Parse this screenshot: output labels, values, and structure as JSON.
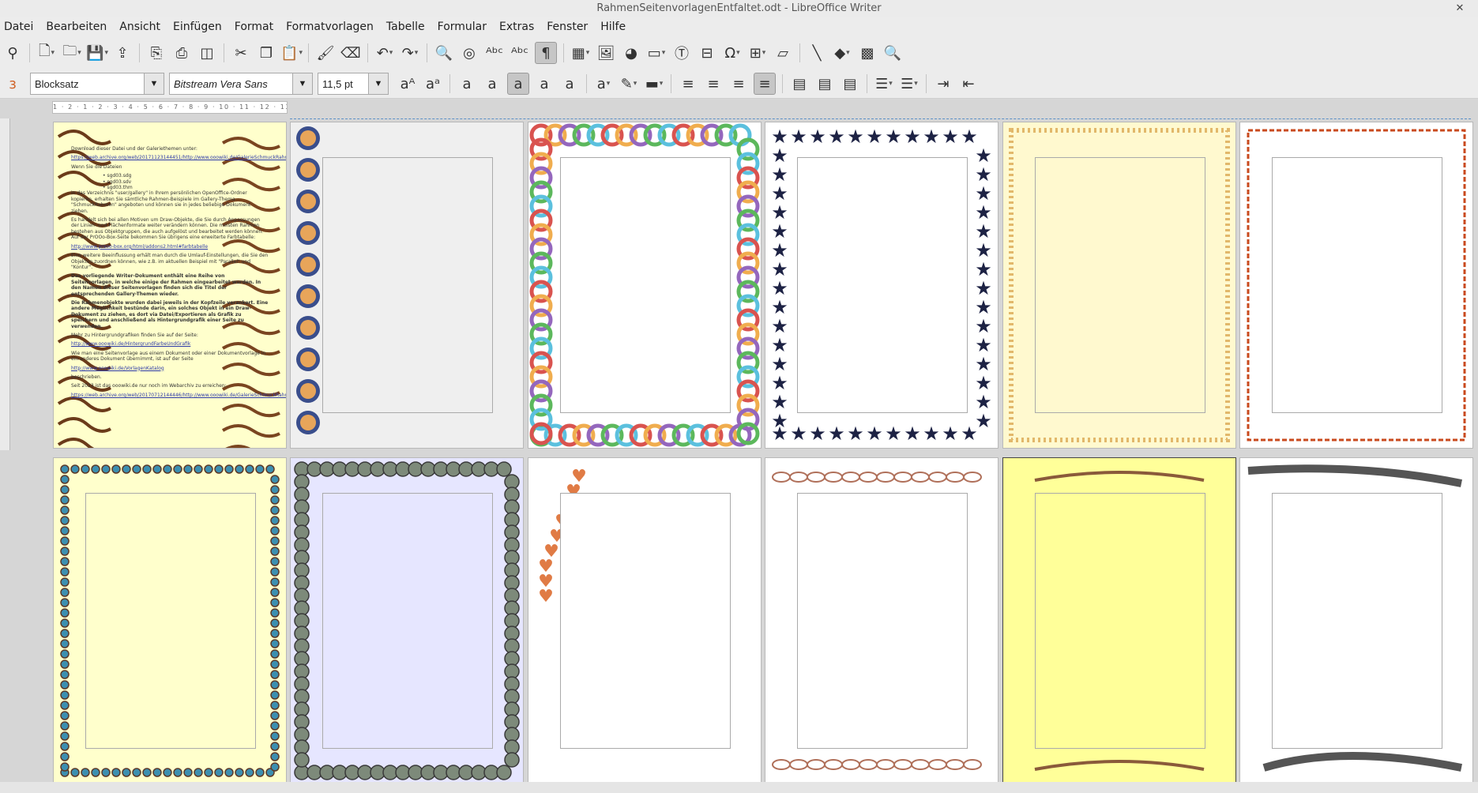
{
  "window": {
    "title": "RahmenSeitenvorlagenEntfaltet.odt - LibreOffice Writer",
    "close": "✕"
  },
  "menu": [
    "Datei",
    "Bearbeiten",
    "Ansicht",
    "Einfügen",
    "Format",
    "Formatvorlagen",
    "Tabelle",
    "Formular",
    "Extras",
    "Fenster",
    "Hilfe"
  ],
  "toolbar1": [
    {
      "name": "binoculars-icon",
      "g": "⚲"
    },
    {
      "sep": true
    },
    {
      "name": "new-document-icon",
      "g": "🗋",
      "dd": true
    },
    {
      "name": "open-icon",
      "g": "🗀",
      "dd": true
    },
    {
      "name": "save-icon",
      "g": "💾",
      "dd": true
    },
    {
      "name": "export-icon",
      "g": "⇪"
    },
    {
      "sep": true
    },
    {
      "name": "export-pdf-icon",
      "g": "⎘"
    },
    {
      "name": "print-icon",
      "g": "⎙"
    },
    {
      "name": "print-preview-icon",
      "g": "◫"
    },
    {
      "sep": true
    },
    {
      "name": "cut-icon",
      "g": "✂"
    },
    {
      "name": "copy-icon",
      "g": "❐"
    },
    {
      "name": "paste-icon",
      "g": "📋",
      "dd": true
    },
    {
      "sep": true
    },
    {
      "name": "clone-formatting-icon",
      "g": "🖌"
    },
    {
      "name": "clear-formatting-icon",
      "g": "⌫"
    },
    {
      "sep": true
    },
    {
      "name": "undo-icon",
      "g": "↶",
      "dd": true
    },
    {
      "name": "redo-icon",
      "g": "↷",
      "dd": true
    },
    {
      "sep": true
    },
    {
      "name": "find-replace-icon",
      "g": "🔍"
    },
    {
      "name": "navigator-icon",
      "g": "◎"
    },
    {
      "name": "spelling-icon",
      "g": "ᴬᵇᶜ"
    },
    {
      "name": "autocheck-icon",
      "g": "ᴬᵇᶜ"
    },
    {
      "name": "formatting-marks-icon",
      "g": "¶",
      "active": true
    },
    {
      "sep": true
    },
    {
      "name": "insert-table-icon",
      "g": "▦",
      "dd": true
    },
    {
      "name": "insert-image-icon",
      "g": "🖼"
    },
    {
      "name": "insert-chart-icon",
      "g": "◕"
    },
    {
      "name": "insert-frame-icon",
      "g": "▭",
      "dd": true
    },
    {
      "name": "insert-textbox-icon",
      "g": "Ⓣ"
    },
    {
      "name": "insert-pagebreak-icon",
      "g": "⊟"
    },
    {
      "name": "special-character-icon",
      "g": "Ω",
      "dd": true
    },
    {
      "name": "insert-field-icon",
      "g": "⊞",
      "dd": true
    },
    {
      "name": "insert-comment-icon",
      "g": "▱"
    },
    {
      "sep": true
    },
    {
      "name": "insert-line-icon",
      "g": "╲"
    },
    {
      "name": "basic-shapes-icon",
      "g": "◆",
      "dd": true
    },
    {
      "name": "gallery-icon",
      "g": "▩"
    },
    {
      "name": "zoom-icon",
      "g": "🔍"
    }
  ],
  "toolbar2": {
    "style_value": "Blocksatz",
    "font_value": "Bitstream Vera Sans",
    "size_value": "11,5 pt",
    "icons_left": [
      {
        "name": "styles-icon",
        "g": "ɜ"
      }
    ],
    "icons": [
      {
        "name": "grow-font-icon",
        "g": "aᴬ"
      },
      {
        "name": "shrink-font-icon",
        "g": "aᵃ"
      },
      {
        "sep": true
      },
      {
        "name": "bold-icon",
        "g": "a"
      },
      {
        "name": "italic-icon",
        "g": "a"
      },
      {
        "name": "underline-icon",
        "g": "a",
        "active": true
      },
      {
        "name": "double-underline-icon",
        "g": "a"
      },
      {
        "name": "strikethrough-icon",
        "g": "a"
      },
      {
        "sep": true
      },
      {
        "name": "font-color-icon",
        "g": "a",
        "dd": true
      },
      {
        "name": "highlight-icon",
        "g": "✎",
        "dd": true
      },
      {
        "name": "character-border-icon",
        "g": "▬",
        "dd": true
      },
      {
        "sep": true
      },
      {
        "name": "align-left-icon",
        "g": "≡"
      },
      {
        "name": "align-center-icon",
        "g": "≡"
      },
      {
        "name": "align-right-icon",
        "g": "≡"
      },
      {
        "name": "justify-icon",
        "g": "≡",
        "active": true
      },
      {
        "sep": true
      },
      {
        "name": "writing-direction-1-icon",
        "g": "▤"
      },
      {
        "name": "writing-direction-2-icon",
        "g": "▤"
      },
      {
        "name": "writing-direction-3-icon",
        "g": "▤"
      },
      {
        "sep": true
      },
      {
        "name": "bullets-icon",
        "g": "☰",
        "dd": true
      },
      {
        "name": "numbering-icon",
        "g": "☰",
        "dd": true
      },
      {
        "sep": true
      },
      {
        "name": "increase-indent-icon",
        "g": "⇥"
      },
      {
        "name": "decrease-indent-icon",
        "g": "⇤"
      }
    ]
  },
  "ruler_text": "1 · 2 · 1 · 2 · 3 · 4 · 5 · 6 · 7 · 8 · 9 · 10 · 11 · 12 · 13 · 14 · 15 · 16 · 17 · 18 · 19",
  "document_text": {
    "p1": "Download dieser Datei und der Galeriethemen unter:",
    "link1": "https://web.archive.org/web/20171123144451/http://www.ooowiki.de/GalerieSchmuckRahmen/Galerie...",
    "p2": "Wenn Sie die Dateien",
    "files": [
      "• sgd03.sdg",
      "• sgd03.sdv",
      "• sgd03.thm"
    ],
    "p3": "in das Verzeichnis \"user/gallery\" in Ihrem persönlichen OpenOffice-Ordner kopieren, erhalten Sie sämtliche Rahmen-Beispiele im Gallery-Thema \"SchmuckRahmen\" angeboten und können sie in jedes beliebige Dokument ziehen.",
    "p4": "Es handelt sich bei allen Motiven um Draw-Objekte, die Sie durch Anpassungen der Linien- und Flächenformate weiter verändern können. Die meisten Rahmen bestehen aus Objektgruppen, die auch aufgelöst und bearbeitet werden können. Auf der PrOOo-Box-Seite bekommen Sie übrigens eine erweiterte Farbtabelle:",
    "link2": "http://www.prooo-box.org/html/addons2.html#farbtabelle",
    "p5": "Eine weitere Beeinflussung erhält man durch die Umlauf-Einstellungen, die Sie den Objekten zuordnen können, wie z.B. im aktuellen Beispiel mit \"Parallel\" und \"Kontur\".",
    "p6": "Das vorliegende Writer-Dokument enthält eine Reihe von Seitenvorlagen, in welche einige der Rahmen eingearbeitet wurden. In den Namen dieser Seitenvorlagen finden sich die Titel der entsprechenden Gallery-Themen wieder.",
    "p7": "Die Rahmenobjekte wurden dabei jeweils in der Kopfzeile verankert. Eine andere Möglichkeit bestünde darin, ein solches Objekt in ein Draw-Dokument zu ziehen, es dort via Datei/Exportieren als Grafik zu speichern und anschließend als Hintergrundgrafik einer Seite zu verwenden.",
    "p8": "Mehr zu Hintergrundgrafiken finden Sie auf der Seite:",
    "link3": "http://www.ooowiki.de/HintergrundFarbeUndGrafik",
    "p9": "Wie man eine Seitenvorlage aus einem Dokument oder einer Dokumentvorlage in ein anderes Dokument übernimmt, ist auf der Seite",
    "link4": "http://www.ooowiki.de/VorlagenKatalog",
    "p10": "beschrieben.",
    "p11": "Seit 2023 ist das ooowiki.de nur noch im Webarchiv zu erreichen:",
    "link5": "https://web.archive.org/web/20170712144446/http://www.ooowiki.de/GalerieSchmuckRahmen"
  },
  "pages": [
    {
      "bg": "#ffffcc",
      "border": "curl"
    },
    {
      "bg": "#efefef",
      "border": "side-balls"
    },
    {
      "bg": "#ffffff",
      "border": "mosaic"
    },
    {
      "bg": "#ffffff",
      "border": "stars"
    },
    {
      "bg": "#fff9cf",
      "border": "gold-vine"
    },
    {
      "bg": "#ffffff",
      "border": "thin-red"
    },
    {
      "bg": "#ffffcc",
      "border": "blue-vine"
    },
    {
      "bg": "#e6e6ff",
      "border": "grey-leaves"
    },
    {
      "bg": "#ffffff",
      "border": "hearts"
    },
    {
      "bg": "#ffffff",
      "border": "top-bottom-swirl"
    },
    {
      "bg": "#ffff99",
      "border": "lotus"
    },
    {
      "bg": "#ffffff",
      "border": "diagonal-vine"
    }
  ],
  "colors": {
    "accent": "#5a8fc7",
    "ui": "#ececec"
  }
}
